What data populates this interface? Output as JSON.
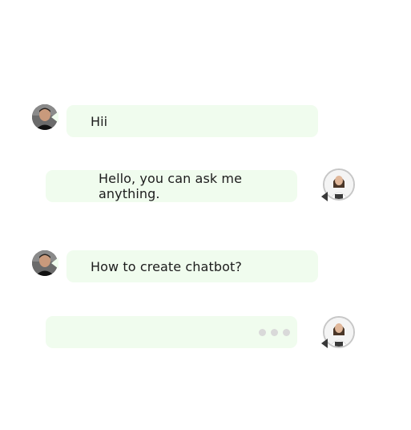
{
  "messages": [
    {
      "sender": "user",
      "text": "Hii"
    },
    {
      "sender": "bot",
      "text": "Hello, you can ask me anything."
    },
    {
      "sender": "user",
      "text": "How to create chatbot?"
    },
    {
      "sender": "bot",
      "typing": true
    }
  ],
  "avatars": {
    "user": "user-avatar-photo",
    "bot": "bot-avatar-photo"
  },
  "colors": {
    "bubble_bg": "#f0fcee",
    "typing_dot": "#d9d9d9",
    "text": "#1c1c1c"
  }
}
